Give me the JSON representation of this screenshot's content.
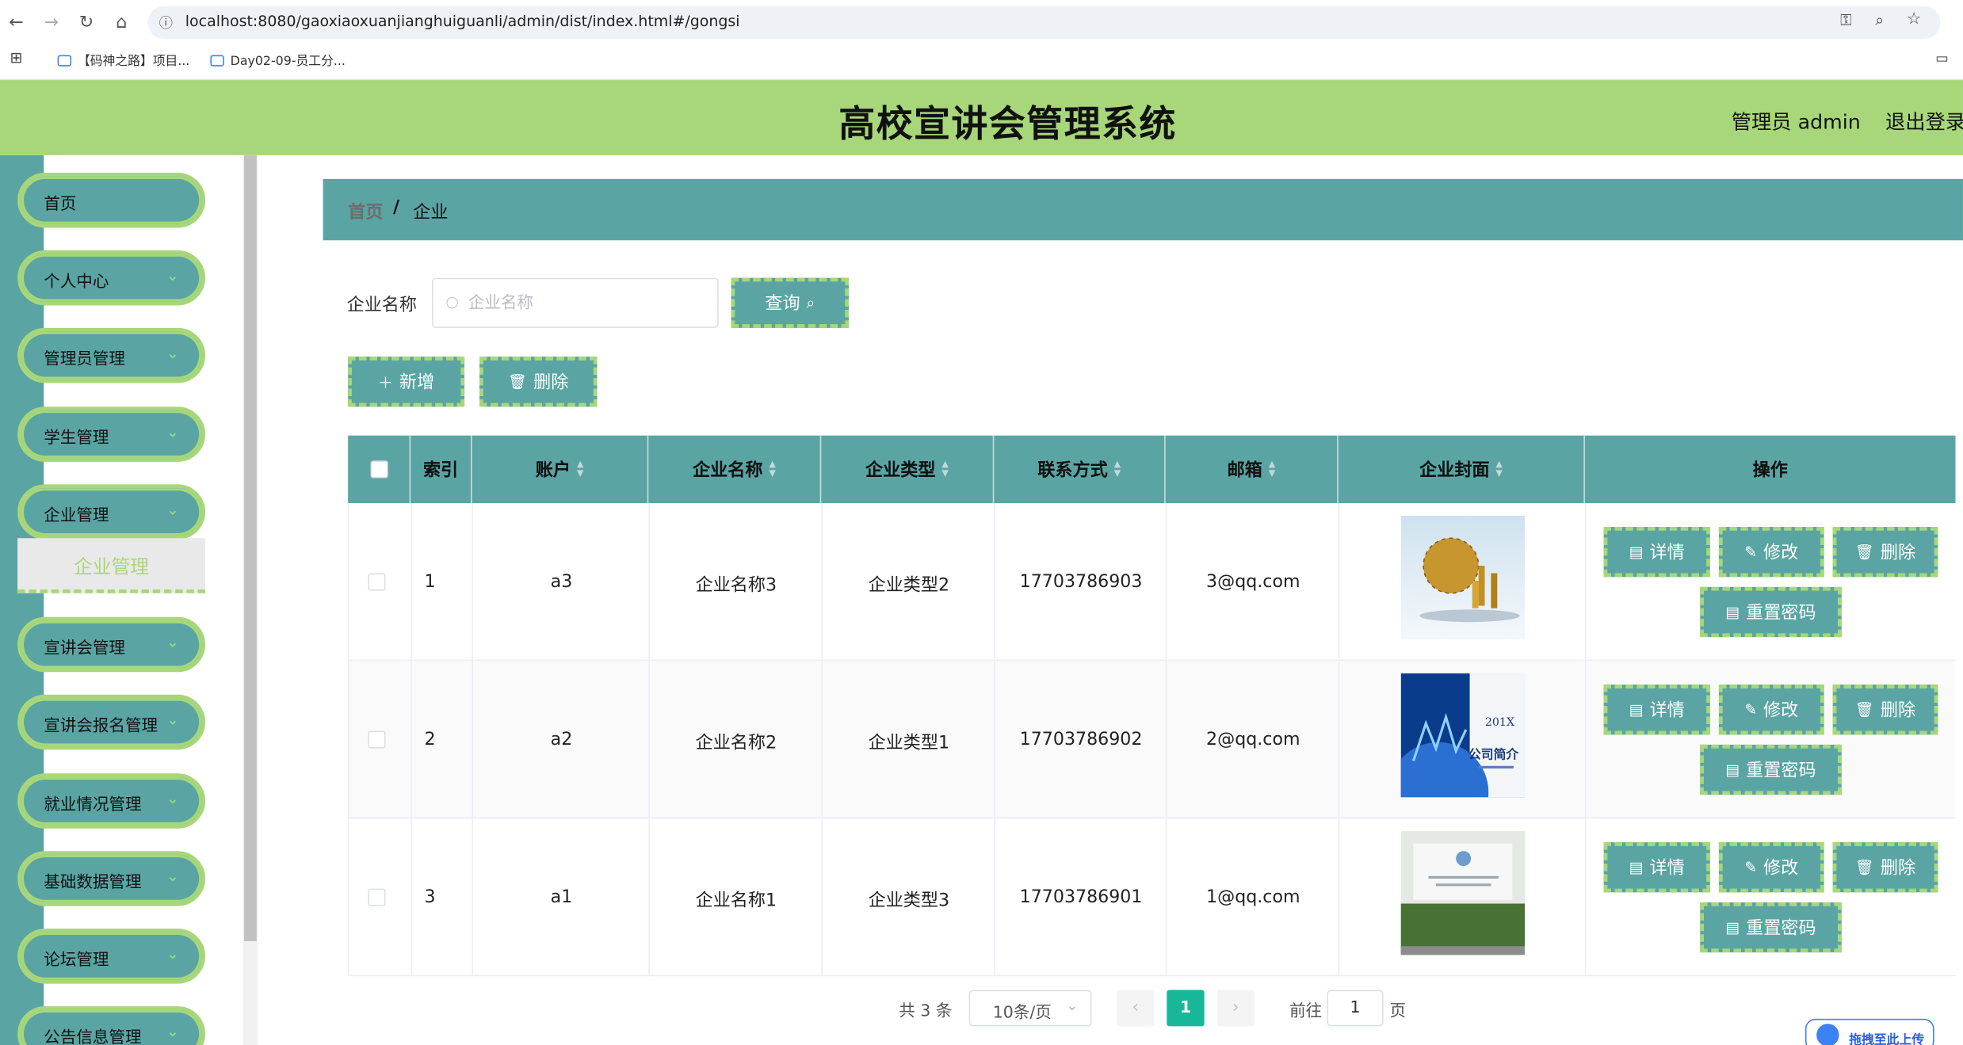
{
  "browser": {
    "url": "localhost:8080/gaoxiaoxuanjianghuiguanli/admin/dist/index.html#/gongsi",
    "bookmarks": [
      "【码神之路】项目...",
      "Day02-09-员工分..."
    ]
  },
  "header": {
    "title": "高校宣讲会管理系统",
    "user": "管理员 admin",
    "logout": "退出登录"
  },
  "sidebar": {
    "items": [
      {
        "label": "首页",
        "has_arrow": false
      },
      {
        "label": "个人中心",
        "has_arrow": true
      },
      {
        "label": "管理员管理",
        "has_arrow": true
      },
      {
        "label": "学生管理",
        "has_arrow": true
      },
      {
        "label": "企业管理",
        "has_arrow": true
      },
      {
        "label": "宣讲会管理",
        "has_arrow": true
      },
      {
        "label": "宣讲会报名管理",
        "has_arrow": true
      },
      {
        "label": "就业情况管理",
        "has_arrow": true
      },
      {
        "label": "基础数据管理",
        "has_arrow": true
      },
      {
        "label": "论坛管理",
        "has_arrow": true
      },
      {
        "label": "公告信息管理",
        "has_arrow": true
      }
    ],
    "active_sub": "企业管理"
  },
  "breadcrumb": {
    "home": "首页",
    "sep": "/",
    "current": "企业"
  },
  "search": {
    "label": "企业名称",
    "placeholder": "企业名称",
    "value": "",
    "button": "查询"
  },
  "actions": {
    "add": "新增",
    "delete": "删除"
  },
  "table": {
    "columns": [
      "索引",
      "账户",
      "企业名称",
      "企业类型",
      "联系方式",
      "邮箱",
      "企业封面",
      "操作"
    ],
    "rows": [
      {
        "index": "1",
        "account": "a3",
        "name": "企业名称3",
        "type": "企业类型2",
        "phone": "17703786903",
        "email": "3@qq.com"
      },
      {
        "index": "2",
        "account": "a2",
        "name": "企业名称2",
        "type": "企业类型1",
        "phone": "17703786902",
        "email": "2@qq.com"
      },
      {
        "index": "3",
        "account": "a1",
        "name": "企业名称1",
        "type": "企业类型3",
        "phone": "17703786901",
        "email": "1@qq.com"
      }
    ],
    "row_actions": {
      "detail": "详情",
      "edit": "修改",
      "delete": "删除",
      "reset": "重置密码"
    },
    "cover_texts": {
      "brochure_year": "201X",
      "brochure_title": "公司简介"
    }
  },
  "pagination": {
    "total": "共 3 条",
    "page_size": "10条/页",
    "current": "1",
    "goto_label": "前往",
    "goto_value": "1",
    "page_suffix": "页"
  },
  "upload_widget": "拖拽至此上传",
  "colors": {
    "primary": "#5aa5a4",
    "accent": "#a7d77a",
    "page_active": "#18b79a"
  }
}
